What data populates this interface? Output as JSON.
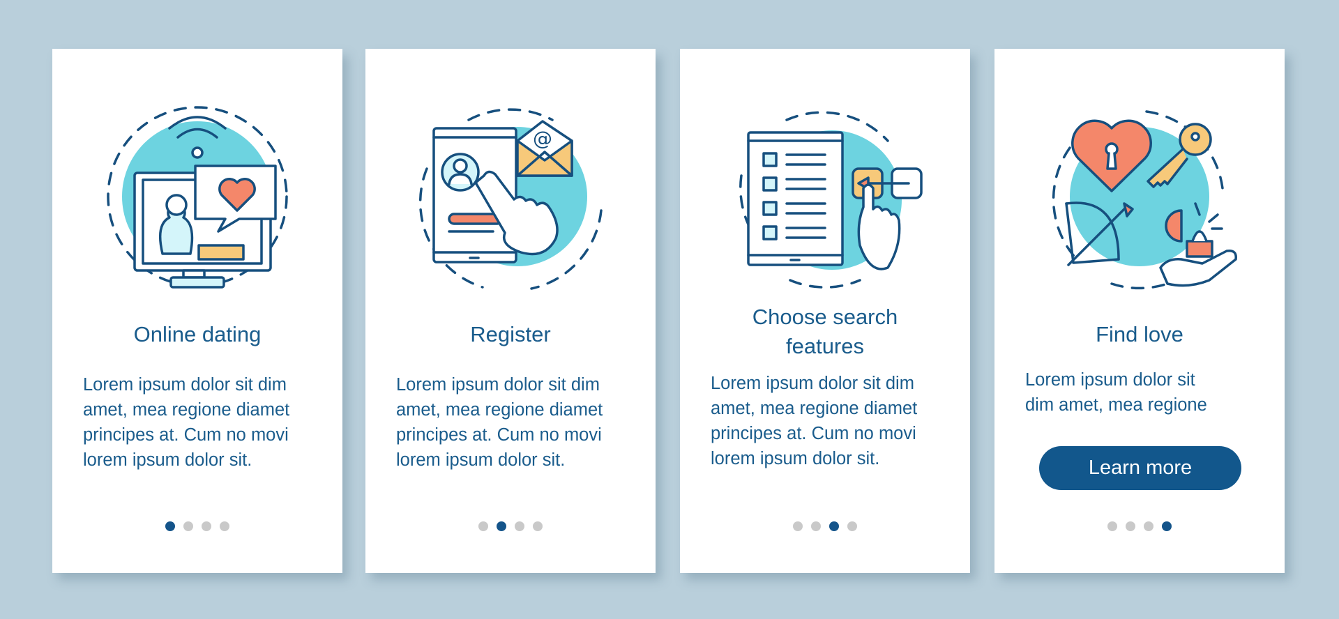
{
  "colors": {
    "background": "#b9cfdb",
    "card": "#ffffff",
    "text": "#1a5c8c",
    "accent": "#12578c",
    "dot_inactive": "#c9c9c9",
    "illustration_circle": "#6dd3e0",
    "illustration_coral": "#f4876a",
    "illustration_yellow": "#f7c97a",
    "illustration_light": "#d4f5fa",
    "illustration_stroke": "#164f7e"
  },
  "screens": [
    {
      "illustration": "online-dating-monitor-icon",
      "title": "Online dating",
      "body": "Lorem ipsum dolor sit dim\namet, mea regione diamet\nprincipes at. Cum no movi\nlorem ipsum dolor sit.",
      "page_index": 1,
      "page_count": 4
    },
    {
      "illustration": "register-tablet-email-icon",
      "title": "Register",
      "body": "Lorem ipsum dolor sit dim\namet, mea regione diamet\nprincipes at. Cum no movi\nlorem ipsum dolor sit.",
      "page_index": 2,
      "page_count": 4
    },
    {
      "illustration": "search-features-checklist-icon",
      "title": "Choose search features",
      "title_lines": [
        "Choose search",
        "features"
      ],
      "body": "Lorem ipsum dolor sit dim\namet, mea regione diamet\nprincipes at. Cum no movi\nlorem ipsum dolor sit.",
      "page_index": 3,
      "page_count": 4
    },
    {
      "illustration": "find-love-heart-key-icon",
      "title": "Find love",
      "body": "Lorem ipsum dolor sit\ndim amet, mea regione",
      "button_label": "Learn more",
      "page_index": 4,
      "page_count": 4
    }
  ]
}
